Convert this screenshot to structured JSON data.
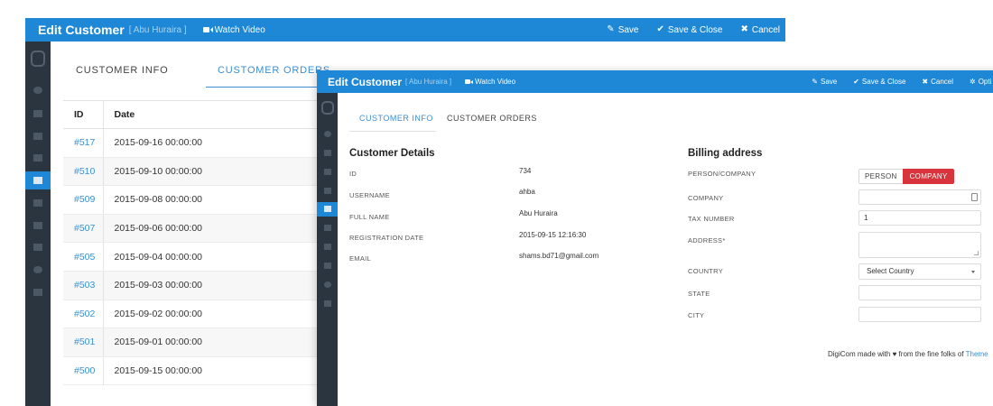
{
  "back_window": {
    "title": "Edit Customer",
    "subtitle": "[ Abu Huraira ]",
    "watch_video": "Watch Video",
    "toolbar": {
      "save": "Save",
      "save_close": "Save & Close",
      "cancel": "Cancel"
    },
    "tabs": [
      "CUSTOMER INFO",
      "CUSTOMER ORDERS"
    ],
    "active_tab": "CUSTOMER ORDERS",
    "orders_table": {
      "columns": [
        "ID",
        "Date"
      ],
      "rows": [
        [
          "#517",
          "2015-09-16 00:00:00"
        ],
        [
          "#510",
          "2015-09-10 00:00:00"
        ],
        [
          "#509",
          "2015-09-08 00:00:00"
        ],
        [
          "#507",
          "2015-09-06 00:00:00"
        ],
        [
          "#505",
          "2015-09-04 00:00:00"
        ],
        [
          "#503",
          "2015-09-03 00:00:00"
        ],
        [
          "#502",
          "2015-09-02 00:00:00"
        ],
        [
          "#501",
          "2015-09-01 00:00:00"
        ],
        [
          "#500",
          "2015-09-15 00:00:00"
        ]
      ]
    }
  },
  "front_window": {
    "title": "Edit Customer",
    "subtitle": "[ Abu Huraira ]",
    "watch_video": "Watch Video",
    "toolbar": {
      "save": "Save",
      "save_close": "Save & Close",
      "cancel": "Cancel",
      "options": "Opti"
    },
    "tabs": [
      "CUSTOMER INFO",
      "CUSTOMER ORDERS"
    ],
    "active_tab": "CUSTOMER INFO",
    "customer_details": {
      "heading": "Customer Details",
      "fields": [
        {
          "label": "ID",
          "value": "734"
        },
        {
          "label": "USERNAME",
          "value": "ahba"
        },
        {
          "label": "FULL NAME",
          "value": "Abu Huraira"
        },
        {
          "label": "REGISTRATION DATE",
          "value": "2015-09-15 12:16:30"
        },
        {
          "label": "EMAIL",
          "value": "shams.bd71@gmail.com"
        }
      ]
    },
    "billing": {
      "heading": "Billing address",
      "person_company_label": "PERSON/COMPANY",
      "person_option": "PERSON",
      "company_option": "COMPANY",
      "selected_option": "COMPANY",
      "company_label": "COMPANY",
      "company_value": "",
      "tax_label": "TAX NUMBER",
      "tax_value": "1",
      "address_label": "ADDRESS*",
      "address_value": "",
      "country_label": "COUNTRY",
      "country_value": "Select Country",
      "state_label": "STATE",
      "state_value": "",
      "city_label": "CITY",
      "city_value": ""
    },
    "footer": {
      "text": "DigiCom made with ♥ from the fine folks of ",
      "link": "Theme"
    }
  },
  "colors": {
    "topbar": "#1e88d6",
    "sidebar": "#2a3540",
    "accent": "#3a8fd4",
    "company_active": "#d9333b"
  },
  "icons": {
    "toolbar": [
      "edit-icon",
      "check-icon",
      "cancel-icon",
      "gear-icon"
    ],
    "sidebar": [
      "logo-icon",
      "dashboard-icon",
      "folder-icon",
      "tags-icon",
      "box-icon",
      "users-icon",
      "cart-icon",
      "tools-icon",
      "chart-icon",
      "help-icon",
      "grid-icon"
    ]
  }
}
